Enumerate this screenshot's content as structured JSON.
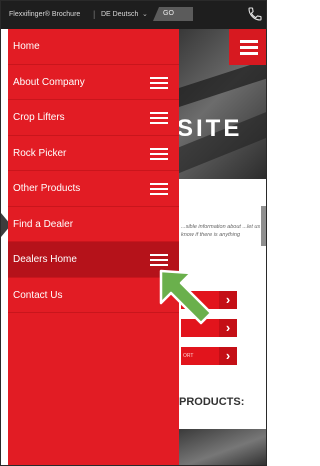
{
  "topbar": {
    "brochure": "Flexxifinger® Brochure",
    "language": "DE Deutsch",
    "chip": "GO"
  },
  "drawer": {
    "items": [
      {
        "label": "Home",
        "has_menu_icon": false
      },
      {
        "label": "About Company",
        "has_menu_icon": true
      },
      {
        "label": "Crop Lifters",
        "has_menu_icon": true
      },
      {
        "label": "Rock Picker",
        "has_menu_icon": true
      },
      {
        "label": "Other Products",
        "has_menu_icon": true
      },
      {
        "label": "Find a Dealer",
        "has_menu_icon": false
      },
      {
        "label": "Dealers Home",
        "has_menu_icon": true,
        "active": true
      },
      {
        "label": "Contact Us",
        "has_menu_icon": false
      }
    ]
  },
  "site": {
    "hero_text": "SITE",
    "paragraph": "...sible information about ...let us know if there is anything",
    "products_heading": "PRODUCTS:",
    "button_arrow": "›",
    "button_small_label": "ORT"
  },
  "colors": {
    "drawer_red": "#e21c24",
    "active_red": "#b5121a",
    "callout_green": "#6ab04c"
  },
  "icons": {
    "menu": "hamburger-icon",
    "phone": "phone-icon",
    "callout": "arrow-up-left-icon"
  }
}
